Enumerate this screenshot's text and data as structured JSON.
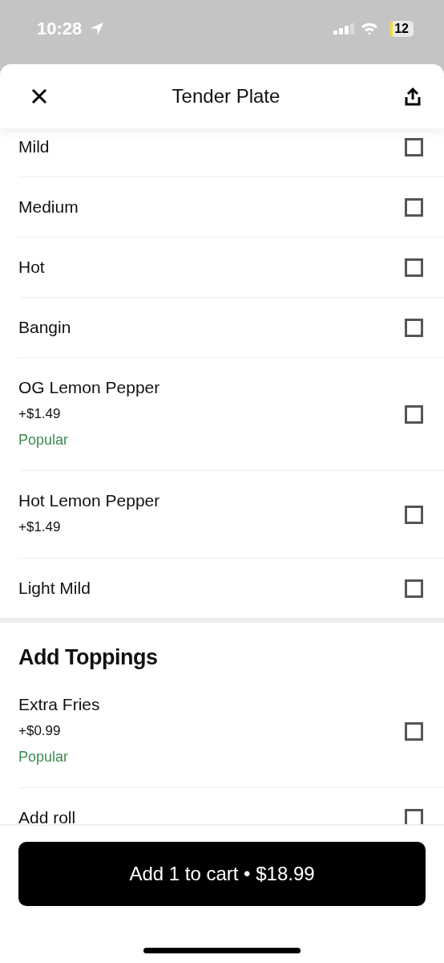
{
  "status_bar": {
    "time": "10:28",
    "battery": "12"
  },
  "header": {
    "title": "Tender Plate"
  },
  "sections": [
    {
      "options": [
        {
          "name": "Mild",
          "checked": false
        },
        {
          "name": "Medium",
          "checked": false
        },
        {
          "name": "Hot",
          "checked": false
        },
        {
          "name": "Bangin",
          "checked": false
        },
        {
          "name": "OG Lemon Pepper",
          "price": "+$1.49",
          "tag": "Popular",
          "checked": false
        },
        {
          "name": "Hot Lemon Pepper",
          "price": "+$1.49",
          "checked": false
        },
        {
          "name": "Light Mild",
          "checked": false
        }
      ]
    },
    {
      "title": "Add Toppings",
      "options": [
        {
          "name": "Extra Fries",
          "price": "+$0.99",
          "tag": "Popular",
          "checked": false
        },
        {
          "name": "Add roll",
          "checked": false
        }
      ]
    }
  ],
  "cart_button": "Add 1 to cart • $18.99"
}
